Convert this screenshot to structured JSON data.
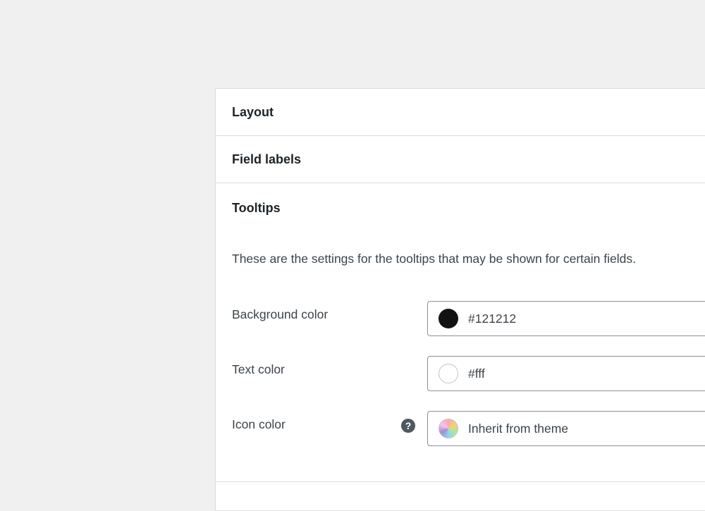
{
  "sections": {
    "layout": {
      "title": "Layout"
    },
    "field_labels": {
      "title": "Field labels"
    },
    "tooltips": {
      "title": "Tooltips",
      "description": "These are the settings for the tooltips that may be shown for certain fields.",
      "rows": [
        {
          "label": "Background color",
          "value": "#121212",
          "swatch_color": "#121212"
        },
        {
          "label": "Text color",
          "value": "#fff",
          "swatch_color": "#ffffff"
        },
        {
          "label": "Icon color",
          "value": "Inherit from theme",
          "swatch_color": "gradient",
          "help_icon": "help-icon"
        }
      ],
      "help_glyph": "?"
    }
  }
}
